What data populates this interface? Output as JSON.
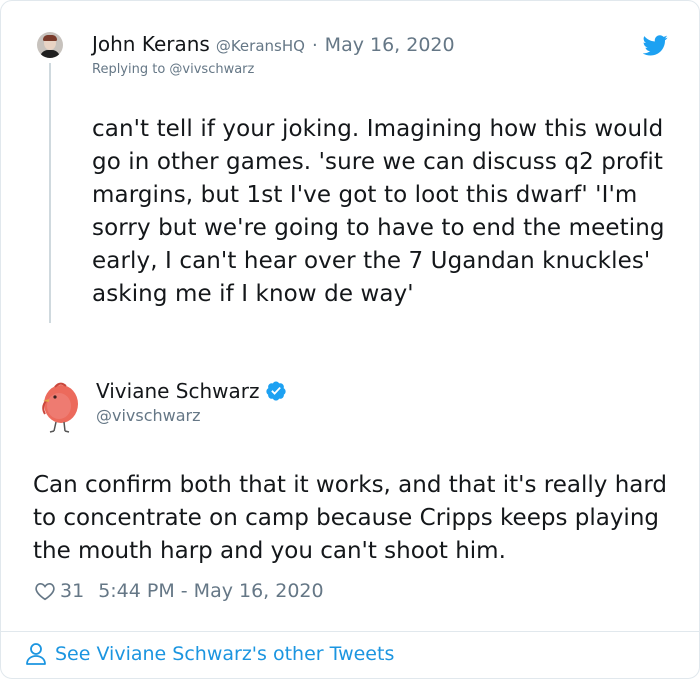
{
  "reply_tweet": {
    "author_name": "John Kerans",
    "author_handle": "@KeransHQ",
    "separator": "·",
    "date": "May 16, 2020",
    "replying_to": "Replying to @vivschwarz",
    "text": "can't tell if your joking. Imagining how this would go in other games. 'sure we can discuss q2 profit margins, but 1st I've got to loot this dwarf' 'I'm sorry but we're going to have to end the meeting early, I can't hear over the 7 Ugandan knuckles' asking me if I know de way'",
    "icons": [
      "avatar-photo",
      "twitter-bird-icon"
    ]
  },
  "main_tweet": {
    "author_name": "Viviane Schwarz",
    "author_handle": "@vivschwarz",
    "verified": true,
    "text": "Can confirm both that it works, and that it's really hard to concentrate on camp because Cripps keeps playing the mouth harp and you can't shoot him.",
    "like_count": "31",
    "timestamp": "5:44 PM - May 16, 2020",
    "icons": [
      "bird-avatar",
      "verified-icon",
      "heart-icon"
    ]
  },
  "footer": {
    "see_more_label": "See Viviane Schwarz's other Tweets",
    "icon": "person-icon"
  },
  "colors": {
    "text": "#14171a",
    "muted": "#657786",
    "link": "#1b95e0",
    "twitter_blue": "#1da1f2",
    "border": "#e1e8ed"
  }
}
